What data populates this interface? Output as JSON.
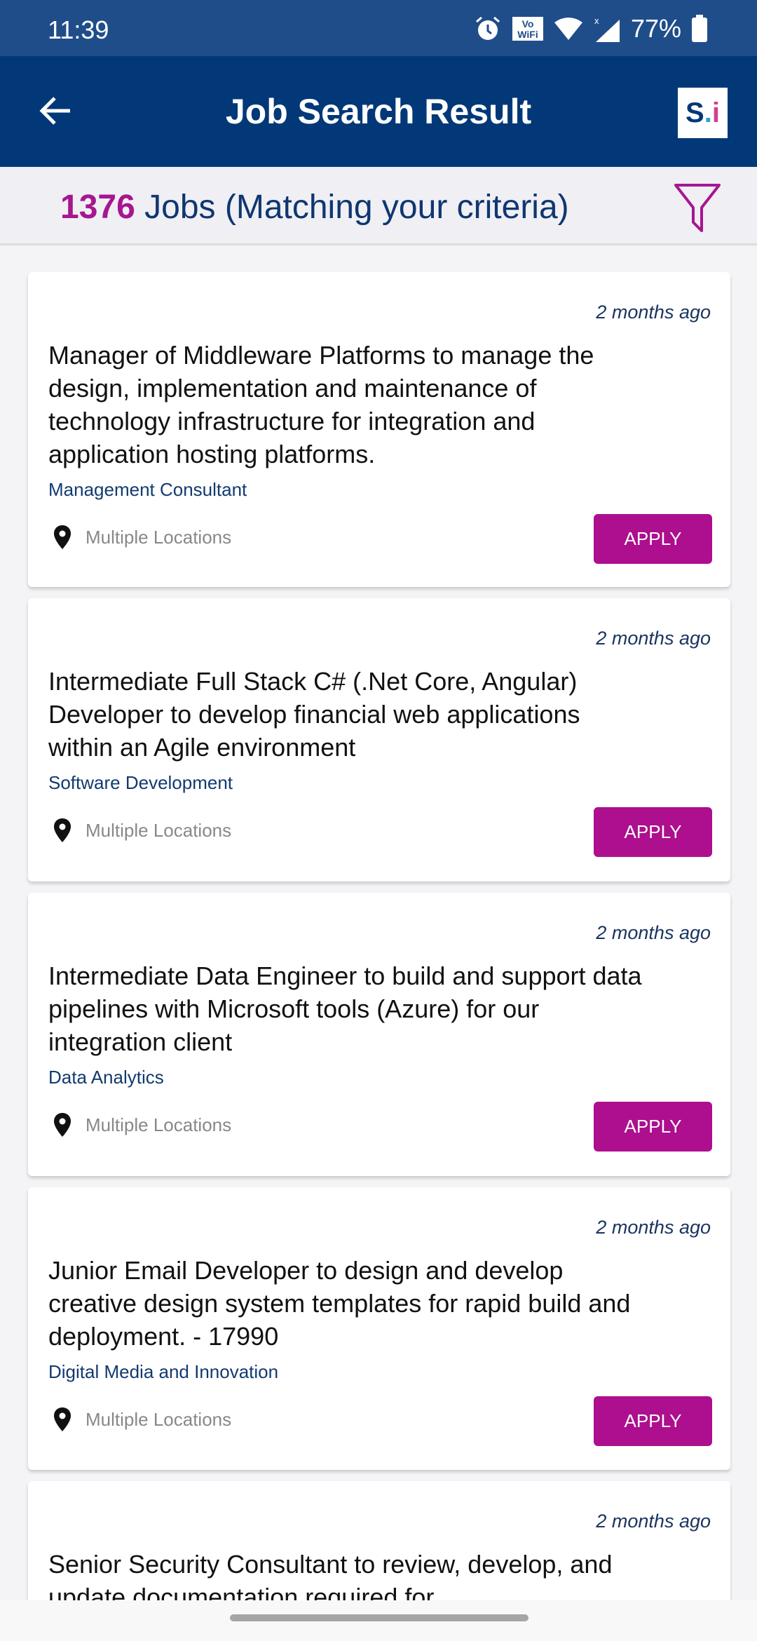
{
  "status_bar": {
    "time": "11:39",
    "battery": "77%",
    "icons": [
      "alarm-icon",
      "vowifi-icon",
      "wifi-icon",
      "signal-icon",
      "battery-icon"
    ],
    "vowifi_label": "Vo WiFi"
  },
  "app_bar": {
    "title": "Job Search Result",
    "logo_text": "S.i."
  },
  "summary": {
    "count": "1376",
    "text": " Jobs (Matching your criteria)"
  },
  "colors": {
    "app_bar": "#033878",
    "status_bar": "#1f4d8a",
    "accent": "#ad0f8e",
    "category": "#123a70"
  },
  "jobs": [
    {
      "ago": "2 months ago",
      "title": "Manager of Middleware Platforms to manage the design, implementation and maintenance of technology infrastructure for integration and application hosting platforms.",
      "category": "Management Consultant",
      "location": "Multiple Locations",
      "apply": "APPLY"
    },
    {
      "ago": "2 months ago",
      "title": "Intermediate Full Stack C# (.Net Core, Angular) Developer to develop financial web applications within an Agile environment",
      "category": "Software Development",
      "location": "Multiple Locations",
      "apply": "APPLY"
    },
    {
      "ago": "2 months ago",
      "title": "Intermediate Data Engineer to build and support data pipelines with Microsoft tools (Azure) for our integration client",
      "category": "Data Analytics",
      "location": "Multiple Locations",
      "apply": "APPLY"
    },
    {
      "ago": "2 months ago",
      "title": "Junior Email Developer to design and develop creative design system templates for rapid build and deployment. - 17990",
      "category": "Digital Media and Innovation",
      "location": "Multiple Locations",
      "apply": "APPLY"
    },
    {
      "ago": "2 months ago",
      "title": "Senior Security Consultant to review, develop, and update documentation required for",
      "category": "",
      "location": "",
      "apply": ""
    }
  ]
}
